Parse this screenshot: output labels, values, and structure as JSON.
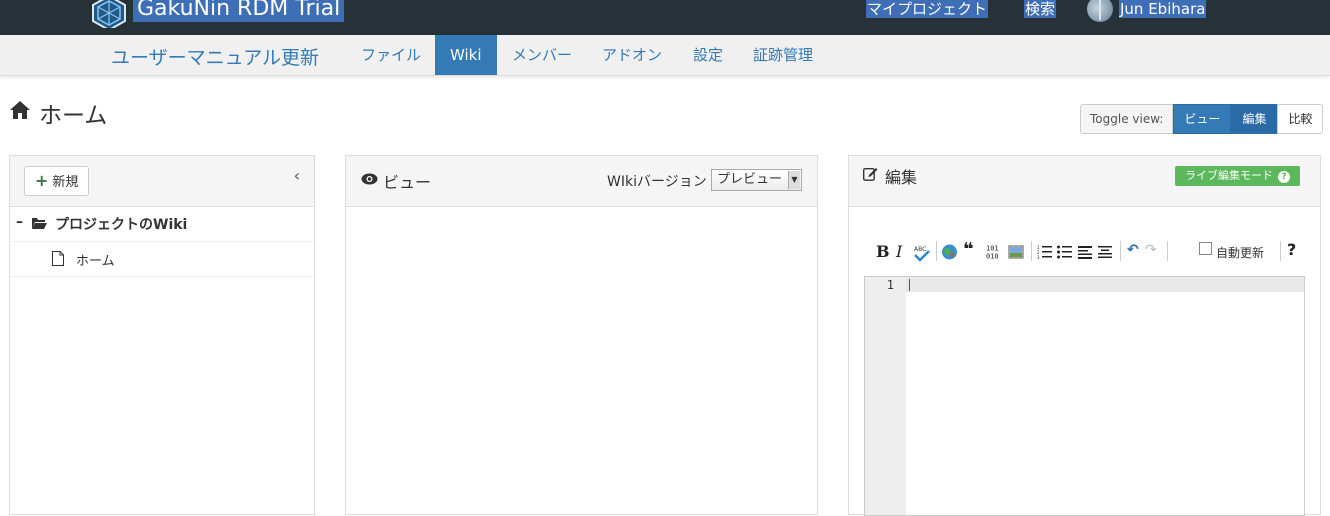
{
  "app": {
    "title": "GakuNin RDM Trial"
  },
  "topnav": {
    "my_projects": "マイプロジェクト",
    "search": "検索",
    "user_name": "Jun Ebihara"
  },
  "project": {
    "title": "ユーザーマニュアル更新",
    "tabs": [
      {
        "label": "ファイル"
      },
      {
        "label": "Wiki"
      },
      {
        "label": "メンバー"
      },
      {
        "label": "アドオン"
      },
      {
        "label": "設定"
      },
      {
        "label": "証跡管理"
      }
    ],
    "active_tab": "Wiki"
  },
  "page": {
    "title": "ホーム",
    "icon": "home-icon"
  },
  "toggle_view": {
    "label": "Toggle view:",
    "buttons": [
      {
        "label": "ビュー",
        "state": "active"
      },
      {
        "label": "編集",
        "state": "active"
      },
      {
        "label": "比較",
        "state": "inactive"
      }
    ]
  },
  "sidebar": {
    "new_button": "新規",
    "collapse_icon": "chevron-left-icon",
    "root": {
      "label": "プロジェクトのWiki",
      "icon": "folder-open-icon"
    },
    "pages": [
      {
        "label": "ホーム",
        "icon": "file-icon"
      }
    ]
  },
  "view_panel": {
    "title": "ビュー",
    "version_label": "WIkiバージョン",
    "version_selected": "プレビュー"
  },
  "edit_panel": {
    "title": "編集",
    "live_mode_button": "ライブ編集モード",
    "toolbar": {
      "bold": "B",
      "italic": "I",
      "auto_refresh_label": "自動更新",
      "auto_refresh_checked": false,
      "help": "?"
    },
    "editor": {
      "line_numbers": [
        "1"
      ],
      "content": ""
    }
  },
  "colors": {
    "topbar": "#263238",
    "primary": "#337ab7",
    "success": "#5cb85c",
    "selection": "#3e6fb6"
  }
}
